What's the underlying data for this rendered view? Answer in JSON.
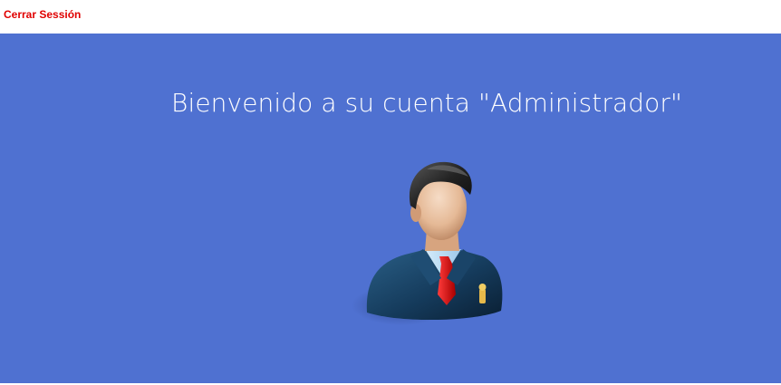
{
  "header": {
    "logout_label": "Cerrar Sessión"
  },
  "main": {
    "welcome_text": "Bienvenido a su cuenta \"Administrador\"",
    "avatar_icon": "administrator-user-icon"
  },
  "colors": {
    "hero_background": "#4f71d1",
    "logout_text": "#e00000",
    "welcome_text": "#ffffff"
  }
}
